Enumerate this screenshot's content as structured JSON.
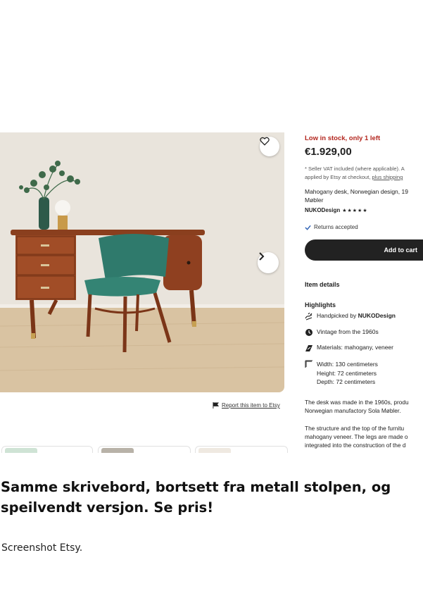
{
  "listing": {
    "stock_notice": "Low in stock, only 1 left",
    "price": "€1.929,00",
    "vat_line1": "* Seller VAT included (where applicable). A",
    "vat_line2_prefix": "applied by Etsy at checkout, ",
    "vat_line2_link": "plus shipping",
    "title_line1": "Mahogany desk, Norwegian design, 19",
    "title_line2": "Møbler",
    "shop_name": "NUKODesign",
    "rating_stars": "★★★★★",
    "returns": "Returns accepted",
    "add_to_cart": "Add to cart",
    "item_details_heading": "Item details",
    "highlights_heading": "Highlights",
    "highlights": {
      "handpicked_prefix": "Handpicked by ",
      "handpicked_shop": "NUKODesign",
      "vintage": "Vintage from the 1960s",
      "materials": "Materials: mahogany, veneer",
      "width": "Width: 130 centimeters",
      "height": "Height: 72 centimeters",
      "depth": "Depth: 72 centimeters"
    },
    "description": [
      "The desk was made in the 1960s, produ",
      "Norwegian manufactory Sola Møbler.",
      "",
      "The structure and the top of the furnitu",
      "mahogany veneer. The legs are made o",
      "integrated into the construction of the d"
    ],
    "report_link": "Report this item to Etsy"
  },
  "icons": {
    "favorite": "heart-icon",
    "next": "chevron-right-icon",
    "report": "flag-icon",
    "returns": "checkmark-icon",
    "handpicked": "hand-icon",
    "vintage": "clock-icon",
    "materials": "material-icon",
    "dimensions": "ruler-icon"
  },
  "colors": {
    "stock_red": "#b3261e",
    "cart_button": "#222222",
    "returns_check": "#2b5fb3"
  },
  "article": {
    "caption": "Samme skrivebord, bortsett fra metall stolpen, og speilvendt versjon. Se pris!",
    "credit": "Screenshot Etsy."
  }
}
